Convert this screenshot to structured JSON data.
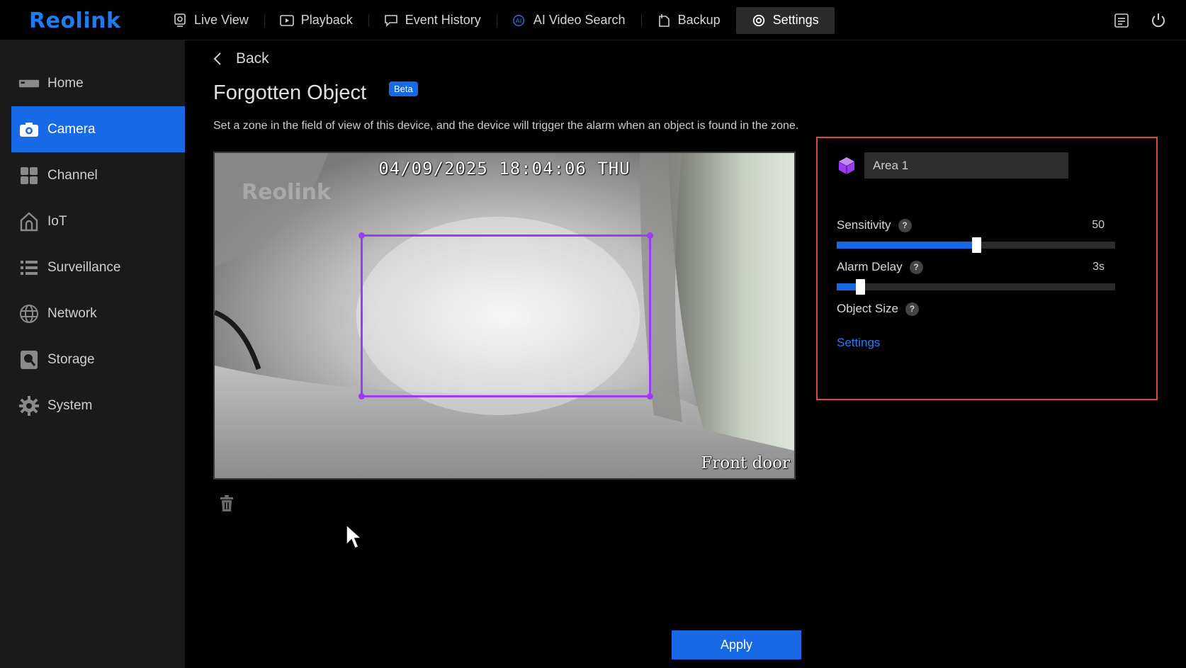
{
  "brand": {
    "logo_text": "Reolink",
    "accent": "#1769e6"
  },
  "topnav": [
    {
      "label": "Live View",
      "icon": "live-view-icon"
    },
    {
      "label": "Playback",
      "icon": "playback-icon"
    },
    {
      "label": "Event History",
      "icon": "event-history-icon"
    },
    {
      "label": "AI Video Search",
      "icon": "ai-search-icon"
    },
    {
      "label": "Backup",
      "icon": "backup-icon"
    },
    {
      "label": "Settings",
      "icon": "gear-icon",
      "active": true
    }
  ],
  "sidebar": {
    "items": [
      {
        "label": "Home",
        "icon": "home-icon"
      },
      {
        "label": "Camera",
        "icon": "camera-icon",
        "active": true
      },
      {
        "label": "Channel",
        "icon": "channel-icon"
      },
      {
        "label": "IoT",
        "icon": "iot-icon"
      },
      {
        "label": "Surveillance",
        "icon": "list-icon"
      },
      {
        "label": "Network",
        "icon": "globe-icon"
      },
      {
        "label": "Storage",
        "icon": "storage-icon"
      },
      {
        "label": "System",
        "icon": "gear-icon"
      }
    ]
  },
  "page": {
    "back_label": "Back",
    "title": "Forgotten Object",
    "badge": "Beta",
    "description": "Set a zone in the field of view of this device, and the device will trigger the alarm when an object is found in the zone."
  },
  "preview": {
    "timestamp": "04/09/2025 18:04:06 THU",
    "camera_name": "Front door",
    "watermark": "Reolink",
    "zone_color": "#9b3cf2"
  },
  "panel": {
    "area_name": "Area 1",
    "sensitivity": {
      "label": "Sensitivity",
      "value": "50",
      "fraction": 0.5
    },
    "alarm_delay": {
      "label": "Alarm Delay",
      "value": "3s",
      "fraction": 0.085
    },
    "object_size": {
      "label": "Object Size",
      "link": "Settings"
    },
    "help_symbol": "?"
  },
  "actions": {
    "apply_label": "Apply"
  }
}
